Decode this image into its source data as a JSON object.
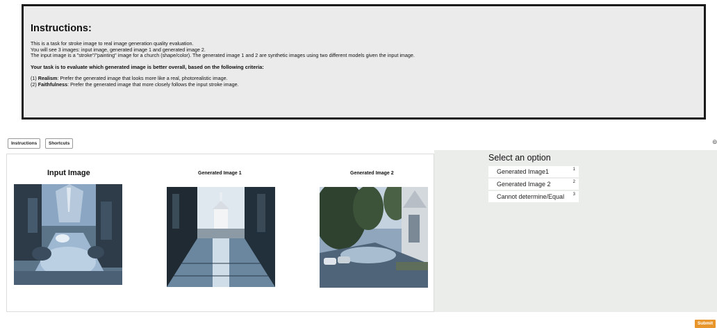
{
  "instructions": {
    "heading": "Instructions:",
    "line1": "This is a task for stroke image to real image generation quality evaluation.",
    "line2": "You will see 3 images: input image, generated image 1 and generated image 2.",
    "line3": "The input image is a \"stroke\"/\"painting\" image for a church (shape/color). The generated image 1 and 2 are synthetic images using two different models given the input image.",
    "task": "Your task is to evaluate which generated image is better overall, based on the following criteria:",
    "c1_label": "Realism",
    "c1_text": ": Prefer the generated image that looks more like a real, photorealistic image.",
    "c1_prefix": "(1) ",
    "c2_prefix": "(2) ",
    "c2_label": "Faithfulness",
    "c2_text": ": Prefer the generated image that more closely follows the input stroke image."
  },
  "toolbar": {
    "instructions_label": "Instructions",
    "shortcuts_label": "Shortcuts",
    "edge_icon": "⊚"
  },
  "images": {
    "input_title": "Input Image",
    "gen1_title": "Generated Image 1",
    "gen2_title": "Generated Image 2"
  },
  "options": {
    "title": "Select an option",
    "items": [
      {
        "label": "Generated Image1",
        "key": "1"
      },
      {
        "label": "Generated Image 2",
        "key": "2"
      },
      {
        "label": "Cannot determine/Equal",
        "key": "3"
      }
    ]
  },
  "submit_label": "Submit",
  "colors": {
    "accent": "#e8962c",
    "panel": "#ebedeb",
    "box": "#ebebeb"
  }
}
